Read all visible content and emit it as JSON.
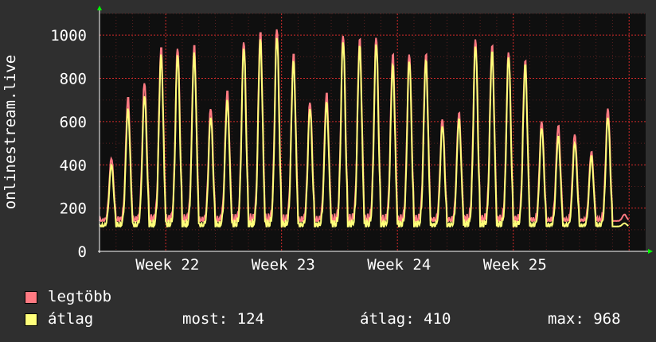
{
  "chart_data": {
    "type": "line",
    "ylabel": "onlinestream.live",
    "ylim": [
      0,
      1100
    ],
    "grid": true,
    "y_ticks": [
      0,
      200,
      400,
      600,
      800,
      1000
    ],
    "x_ticks": [
      "Week 22",
      "Week 23",
      "Week 24",
      "Week 25"
    ],
    "days": 33,
    "series": [
      {
        "name": "legtöbb",
        "color": "#ff7a82",
        "daily_peaks": [
          430,
          710,
          780,
          940,
          940,
          950,
          660,
          740,
          970,
          1010,
          1030,
          910,
          690,
          730,
          1000,
          980,
          990,
          910,
          910,
          910,
          610,
          640,
          980,
          950,
          920,
          880,
          600,
          580,
          540,
          460,
          660,
          170
        ]
      },
      {
        "name": "átlag",
        "color": "#ffff7a",
        "daily_peaks": [
          400,
          660,
          720,
          910,
          910,
          920,
          620,
          700,
          940,
          980,
          990,
          880,
          660,
          690,
          970,
          950,
          960,
          860,
          880,
          880,
          580,
          610,
          950,
          920,
          900,
          860,
          570,
          530,
          500,
          440,
          620,
          130
        ]
      }
    ]
  },
  "legend": {
    "max_label": "legtöbb",
    "avg_label": "átlag",
    "current": "most: 124",
    "average": "átlag: 410",
    "maximum": "max: 968"
  },
  "colors": {
    "background": "#2f2f2f",
    "plot": "#0f0f0f",
    "grid": "#c02020",
    "axis_arrow": "#00ff00"
  }
}
